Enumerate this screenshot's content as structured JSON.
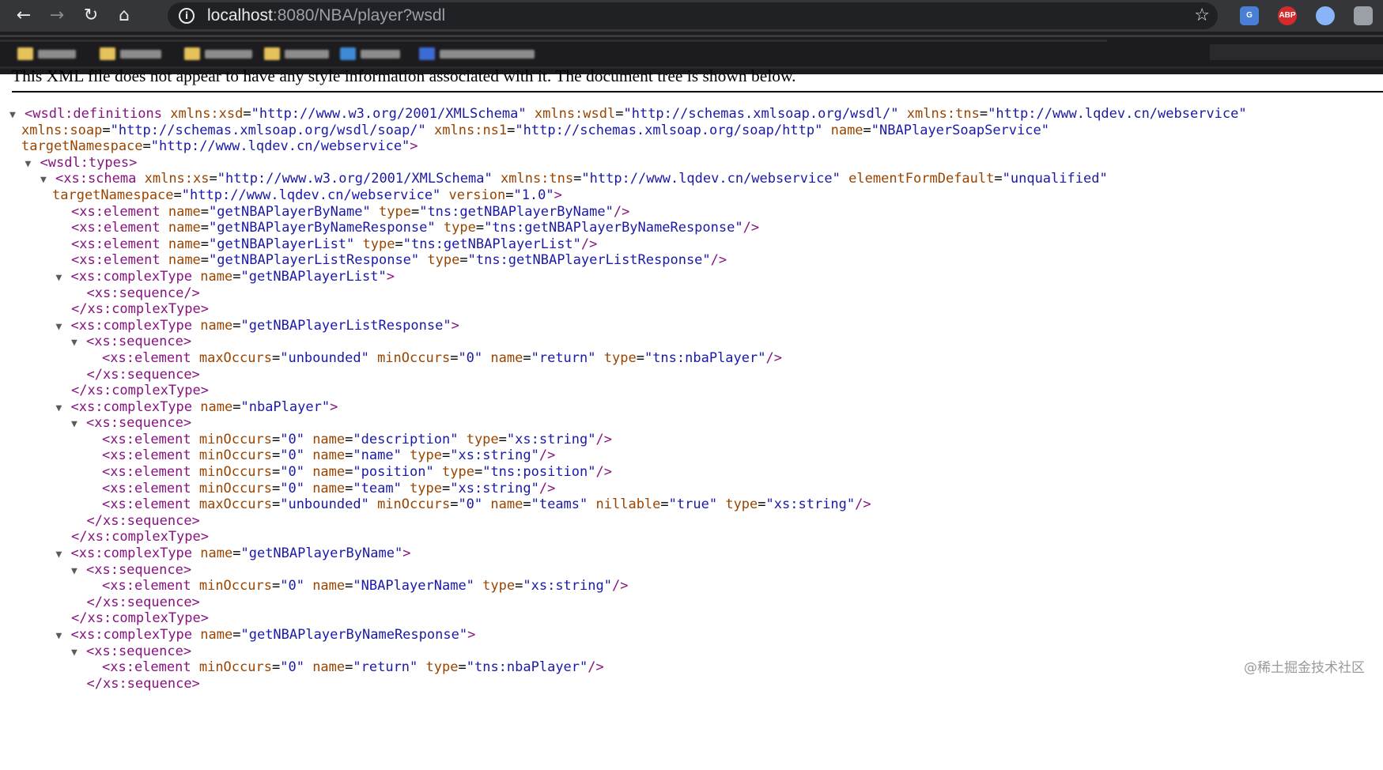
{
  "browser": {
    "url_host": "localhost",
    "url_path": ":8080/NBA/player?wsdl",
    "extensions": [
      {
        "name": "google-translate-extension",
        "label": "G",
        "color": "#4a7fd6"
      },
      {
        "name": "adblock-plus-extension",
        "label": "ABP",
        "color": "#d32b2b"
      },
      {
        "name": "circle-extension",
        "label": "",
        "color": "#8ab4f8"
      },
      {
        "name": "puzzle-extension",
        "label": "",
        "color": "#9aa0a6"
      }
    ],
    "bookmarks_blurred": true
  },
  "notice": "This XML file does not appear to have any style information associated with it. The document tree is shown below.",
  "xml_lines": [
    {
      "indent": 0,
      "toggle": "▼",
      "t": [
        [
          "tg",
          "<wsdl:definitions"
        ],
        [
          "tx",
          " "
        ],
        [
          "an",
          "xmlns:xsd"
        ],
        [
          "tx",
          "="
        ],
        [
          "av",
          "\"http://www.w3.org/2001/XMLSchema\""
        ],
        [
          "tx",
          " "
        ],
        [
          "an",
          "xmlns:wsdl"
        ],
        [
          "tx",
          "="
        ],
        [
          "av",
          "\"http://schemas.xmlsoap.org/wsdl/\""
        ],
        [
          "tx",
          " "
        ],
        [
          "an",
          "xmlns:tns"
        ],
        [
          "tx",
          "="
        ],
        [
          "av",
          "\"http://www.lqdev.cn/webservice\""
        ]
      ]
    },
    {
      "indent": 0,
      "toggle": "",
      "cont": true,
      "t": [
        [
          "an",
          "xmlns:soap"
        ],
        [
          "tx",
          "="
        ],
        [
          "av",
          "\"http://schemas.xmlsoap.org/wsdl/soap/\""
        ],
        [
          "tx",
          " "
        ],
        [
          "an",
          "xmlns:ns1"
        ],
        [
          "tx",
          "="
        ],
        [
          "av",
          "\"http://schemas.xmlsoap.org/soap/http\""
        ],
        [
          "tx",
          " "
        ],
        [
          "an",
          "name"
        ],
        [
          "tx",
          "="
        ],
        [
          "av",
          "\"NBAPlayerSoapService\""
        ]
      ]
    },
    {
      "indent": 0,
      "toggle": "",
      "cont": true,
      "t": [
        [
          "an",
          "targetNamespace"
        ],
        [
          "tx",
          "="
        ],
        [
          "av",
          "\"http://www.lqdev.cn/webservice\""
        ],
        [
          "tg",
          ">"
        ]
      ]
    },
    {
      "indent": 1,
      "toggle": "▼",
      "t": [
        [
          "tg",
          "<wsdl:types>"
        ]
      ]
    },
    {
      "indent": 2,
      "toggle": "▼",
      "t": [
        [
          "tg",
          "<xs:schema"
        ],
        [
          "tx",
          " "
        ],
        [
          "an",
          "xmlns:xs"
        ],
        [
          "tx",
          "="
        ],
        [
          "av",
          "\"http://www.w3.org/2001/XMLSchema\""
        ],
        [
          "tx",
          " "
        ],
        [
          "an",
          "xmlns:tns"
        ],
        [
          "tx",
          "="
        ],
        [
          "av",
          "\"http://www.lqdev.cn/webservice\""
        ],
        [
          "tx",
          " "
        ],
        [
          "an",
          "elementFormDefault"
        ],
        [
          "tx",
          "="
        ],
        [
          "av",
          "\"unqualified\""
        ]
      ]
    },
    {
      "indent": 2,
      "toggle": "",
      "cont": true,
      "t": [
        [
          "an",
          "targetNamespace"
        ],
        [
          "tx",
          "="
        ],
        [
          "av",
          "\"http://www.lqdev.cn/webservice\""
        ],
        [
          "tx",
          " "
        ],
        [
          "an",
          "version"
        ],
        [
          "tx",
          "="
        ],
        [
          "av",
          "\"1.0\""
        ],
        [
          "tg",
          ">"
        ]
      ]
    },
    {
      "indent": 3,
      "toggle": "",
      "t": [
        [
          "tg",
          "<xs:element"
        ],
        [
          "tx",
          " "
        ],
        [
          "an",
          "name"
        ],
        [
          "tx",
          "="
        ],
        [
          "av",
          "\"getNBAPlayerByName\""
        ],
        [
          "tx",
          " "
        ],
        [
          "an",
          "type"
        ],
        [
          "tx",
          "="
        ],
        [
          "av",
          "\"tns:getNBAPlayerByName\""
        ],
        [
          "tg",
          "/>"
        ]
      ]
    },
    {
      "indent": 3,
      "toggle": "",
      "t": [
        [
          "tg",
          "<xs:element"
        ],
        [
          "tx",
          " "
        ],
        [
          "an",
          "name"
        ],
        [
          "tx",
          "="
        ],
        [
          "av",
          "\"getNBAPlayerByNameResponse\""
        ],
        [
          "tx",
          " "
        ],
        [
          "an",
          "type"
        ],
        [
          "tx",
          "="
        ],
        [
          "av",
          "\"tns:getNBAPlayerByNameResponse\""
        ],
        [
          "tg",
          "/>"
        ]
      ]
    },
    {
      "indent": 3,
      "toggle": "",
      "t": [
        [
          "tg",
          "<xs:element"
        ],
        [
          "tx",
          " "
        ],
        [
          "an",
          "name"
        ],
        [
          "tx",
          "="
        ],
        [
          "av",
          "\"getNBAPlayerList\""
        ],
        [
          "tx",
          " "
        ],
        [
          "an",
          "type"
        ],
        [
          "tx",
          "="
        ],
        [
          "av",
          "\"tns:getNBAPlayerList\""
        ],
        [
          "tg",
          "/>"
        ]
      ]
    },
    {
      "indent": 3,
      "toggle": "",
      "t": [
        [
          "tg",
          "<xs:element"
        ],
        [
          "tx",
          " "
        ],
        [
          "an",
          "name"
        ],
        [
          "tx",
          "="
        ],
        [
          "av",
          "\"getNBAPlayerListResponse\""
        ],
        [
          "tx",
          " "
        ],
        [
          "an",
          "type"
        ],
        [
          "tx",
          "="
        ],
        [
          "av",
          "\"tns:getNBAPlayerListResponse\""
        ],
        [
          "tg",
          "/>"
        ]
      ]
    },
    {
      "indent": 3,
      "toggle": "▼",
      "t": [
        [
          "tg",
          "<xs:complexType"
        ],
        [
          "tx",
          " "
        ],
        [
          "an",
          "name"
        ],
        [
          "tx",
          "="
        ],
        [
          "av",
          "\"getNBAPlayerList\""
        ],
        [
          "tg",
          ">"
        ]
      ]
    },
    {
      "indent": 4,
      "toggle": "",
      "t": [
        [
          "tg",
          "<xs:sequence/>"
        ]
      ]
    },
    {
      "indent": 3,
      "toggle": "",
      "t": [
        [
          "tg",
          "</xs:complexType>"
        ]
      ]
    },
    {
      "indent": 3,
      "toggle": "▼",
      "t": [
        [
          "tg",
          "<xs:complexType"
        ],
        [
          "tx",
          " "
        ],
        [
          "an",
          "name"
        ],
        [
          "tx",
          "="
        ],
        [
          "av",
          "\"getNBAPlayerListResponse\""
        ],
        [
          "tg",
          ">"
        ]
      ]
    },
    {
      "indent": 4,
      "toggle": "▼",
      "t": [
        [
          "tg",
          "<xs:sequence>"
        ]
      ]
    },
    {
      "indent": 5,
      "toggle": "",
      "t": [
        [
          "tg",
          "<xs:element"
        ],
        [
          "tx",
          " "
        ],
        [
          "an",
          "maxOccurs"
        ],
        [
          "tx",
          "="
        ],
        [
          "av",
          "\"unbounded\""
        ],
        [
          "tx",
          " "
        ],
        [
          "an",
          "minOccurs"
        ],
        [
          "tx",
          "="
        ],
        [
          "av",
          "\"0\""
        ],
        [
          "tx",
          " "
        ],
        [
          "an",
          "name"
        ],
        [
          "tx",
          "="
        ],
        [
          "av",
          "\"return\""
        ],
        [
          "tx",
          " "
        ],
        [
          "an",
          "type"
        ],
        [
          "tx",
          "="
        ],
        [
          "av",
          "\"tns:nbaPlayer\""
        ],
        [
          "tg",
          "/>"
        ]
      ]
    },
    {
      "indent": 4,
      "toggle": "",
      "t": [
        [
          "tg",
          "</xs:sequence>"
        ]
      ]
    },
    {
      "indent": 3,
      "toggle": "",
      "t": [
        [
          "tg",
          "</xs:complexType>"
        ]
      ]
    },
    {
      "indent": 3,
      "toggle": "▼",
      "t": [
        [
          "tg",
          "<xs:complexType"
        ],
        [
          "tx",
          " "
        ],
        [
          "an",
          "name"
        ],
        [
          "tx",
          "="
        ],
        [
          "av",
          "\"nbaPlayer\""
        ],
        [
          "tg",
          ">"
        ]
      ]
    },
    {
      "indent": 4,
      "toggle": "▼",
      "t": [
        [
          "tg",
          "<xs:sequence>"
        ]
      ]
    },
    {
      "indent": 5,
      "toggle": "",
      "t": [
        [
          "tg",
          "<xs:element"
        ],
        [
          "tx",
          " "
        ],
        [
          "an",
          "minOccurs"
        ],
        [
          "tx",
          "="
        ],
        [
          "av",
          "\"0\""
        ],
        [
          "tx",
          " "
        ],
        [
          "an",
          "name"
        ],
        [
          "tx",
          "="
        ],
        [
          "av",
          "\"description\""
        ],
        [
          "tx",
          " "
        ],
        [
          "an",
          "type"
        ],
        [
          "tx",
          "="
        ],
        [
          "av",
          "\"xs:string\""
        ],
        [
          "tg",
          "/>"
        ]
      ]
    },
    {
      "indent": 5,
      "toggle": "",
      "t": [
        [
          "tg",
          "<xs:element"
        ],
        [
          "tx",
          " "
        ],
        [
          "an",
          "minOccurs"
        ],
        [
          "tx",
          "="
        ],
        [
          "av",
          "\"0\""
        ],
        [
          "tx",
          " "
        ],
        [
          "an",
          "name"
        ],
        [
          "tx",
          "="
        ],
        [
          "av",
          "\"name\""
        ],
        [
          "tx",
          " "
        ],
        [
          "an",
          "type"
        ],
        [
          "tx",
          "="
        ],
        [
          "av",
          "\"xs:string\""
        ],
        [
          "tg",
          "/>"
        ]
      ]
    },
    {
      "indent": 5,
      "toggle": "",
      "t": [
        [
          "tg",
          "<xs:element"
        ],
        [
          "tx",
          " "
        ],
        [
          "an",
          "minOccurs"
        ],
        [
          "tx",
          "="
        ],
        [
          "av",
          "\"0\""
        ],
        [
          "tx",
          " "
        ],
        [
          "an",
          "name"
        ],
        [
          "tx",
          "="
        ],
        [
          "av",
          "\"position\""
        ],
        [
          "tx",
          " "
        ],
        [
          "an",
          "type"
        ],
        [
          "tx",
          "="
        ],
        [
          "av",
          "\"tns:position\""
        ],
        [
          "tg",
          "/>"
        ]
      ]
    },
    {
      "indent": 5,
      "toggle": "",
      "t": [
        [
          "tg",
          "<xs:element"
        ],
        [
          "tx",
          " "
        ],
        [
          "an",
          "minOccurs"
        ],
        [
          "tx",
          "="
        ],
        [
          "av",
          "\"0\""
        ],
        [
          "tx",
          " "
        ],
        [
          "an",
          "name"
        ],
        [
          "tx",
          "="
        ],
        [
          "av",
          "\"team\""
        ],
        [
          "tx",
          " "
        ],
        [
          "an",
          "type"
        ],
        [
          "tx",
          "="
        ],
        [
          "av",
          "\"xs:string\""
        ],
        [
          "tg",
          "/>"
        ]
      ]
    },
    {
      "indent": 5,
      "toggle": "",
      "t": [
        [
          "tg",
          "<xs:element"
        ],
        [
          "tx",
          " "
        ],
        [
          "an",
          "maxOccurs"
        ],
        [
          "tx",
          "="
        ],
        [
          "av",
          "\"unbounded\""
        ],
        [
          "tx",
          " "
        ],
        [
          "an",
          "minOccurs"
        ],
        [
          "tx",
          "="
        ],
        [
          "av",
          "\"0\""
        ],
        [
          "tx",
          " "
        ],
        [
          "an",
          "name"
        ],
        [
          "tx",
          "="
        ],
        [
          "av",
          "\"teams\""
        ],
        [
          "tx",
          " "
        ],
        [
          "an",
          "nillable"
        ],
        [
          "tx",
          "="
        ],
        [
          "av",
          "\"true\""
        ],
        [
          "tx",
          " "
        ],
        [
          "an",
          "type"
        ],
        [
          "tx",
          "="
        ],
        [
          "av",
          "\"xs:string\""
        ],
        [
          "tg",
          "/>"
        ]
      ]
    },
    {
      "indent": 4,
      "toggle": "",
      "t": [
        [
          "tg",
          "</xs:sequence>"
        ]
      ]
    },
    {
      "indent": 3,
      "toggle": "",
      "t": [
        [
          "tg",
          "</xs:complexType>"
        ]
      ]
    },
    {
      "indent": 3,
      "toggle": "▼",
      "t": [
        [
          "tg",
          "<xs:complexType"
        ],
        [
          "tx",
          " "
        ],
        [
          "an",
          "name"
        ],
        [
          "tx",
          "="
        ],
        [
          "av",
          "\"getNBAPlayerByName\""
        ],
        [
          "tg",
          ">"
        ]
      ]
    },
    {
      "indent": 4,
      "toggle": "▼",
      "t": [
        [
          "tg",
          "<xs:sequence>"
        ]
      ]
    },
    {
      "indent": 5,
      "toggle": "",
      "t": [
        [
          "tg",
          "<xs:element"
        ],
        [
          "tx",
          " "
        ],
        [
          "an",
          "minOccurs"
        ],
        [
          "tx",
          "="
        ],
        [
          "av",
          "\"0\""
        ],
        [
          "tx",
          " "
        ],
        [
          "an",
          "name"
        ],
        [
          "tx",
          "="
        ],
        [
          "av",
          "\"NBAPlayerName\""
        ],
        [
          "tx",
          " "
        ],
        [
          "an",
          "type"
        ],
        [
          "tx",
          "="
        ],
        [
          "av",
          "\"xs:string\""
        ],
        [
          "tg",
          "/>"
        ]
      ]
    },
    {
      "indent": 4,
      "toggle": "",
      "t": [
        [
          "tg",
          "</xs:sequence>"
        ]
      ]
    },
    {
      "indent": 3,
      "toggle": "",
      "t": [
        [
          "tg",
          "</xs:complexType>"
        ]
      ]
    },
    {
      "indent": 3,
      "toggle": "▼",
      "t": [
        [
          "tg",
          "<xs:complexType"
        ],
        [
          "tx",
          " "
        ],
        [
          "an",
          "name"
        ],
        [
          "tx",
          "="
        ],
        [
          "av",
          "\"getNBAPlayerByNameResponse\""
        ],
        [
          "tg",
          ">"
        ]
      ]
    },
    {
      "indent": 4,
      "toggle": "▼",
      "t": [
        [
          "tg",
          "<xs:sequence>"
        ]
      ]
    },
    {
      "indent": 5,
      "toggle": "",
      "t": [
        [
          "tg",
          "<xs:element"
        ],
        [
          "tx",
          " "
        ],
        [
          "an",
          "minOccurs"
        ],
        [
          "tx",
          "="
        ],
        [
          "av",
          "\"0\""
        ],
        [
          "tx",
          " "
        ],
        [
          "an",
          "name"
        ],
        [
          "tx",
          "="
        ],
        [
          "av",
          "\"return\""
        ],
        [
          "tx",
          " "
        ],
        [
          "an",
          "type"
        ],
        [
          "tx",
          "="
        ],
        [
          "av",
          "\"tns:nbaPlayer\""
        ],
        [
          "tg",
          "/>"
        ]
      ]
    },
    {
      "indent": 4,
      "toggle": "",
      "t": [
        [
          "tg",
          "</xs:sequence>"
        ]
      ]
    }
  ],
  "watermark": "@稀土掘金技术社区"
}
